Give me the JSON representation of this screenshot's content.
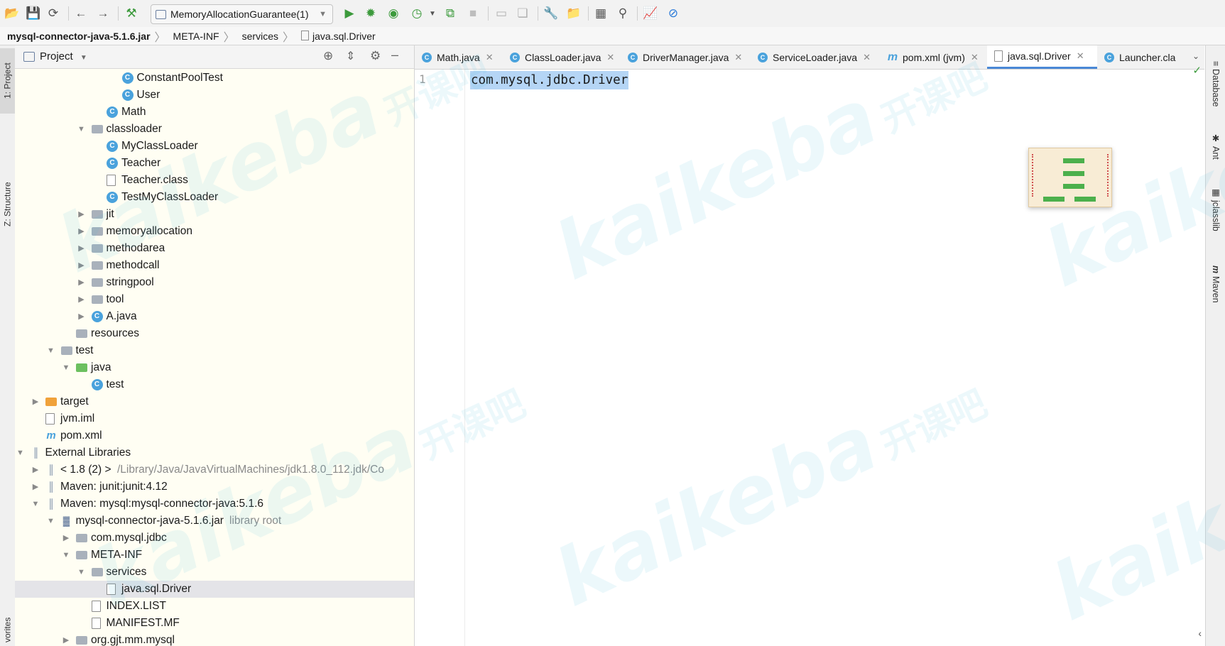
{
  "toolbar": {
    "run_config": "MemoryAllocationGuarantee(1)",
    "icons": [
      "open-folder-icon",
      "save-icon",
      "sync-icon",
      "back-icon",
      "forward-icon",
      "build-hammer-icon",
      "run-icon",
      "debug-icon",
      "coverage-icon",
      "profile-icon",
      "attach-debugger-icon",
      "stop-icon",
      "device-icon",
      "device-manager-icon",
      "settings-wrench-icon",
      "project-structure-icon",
      "terminal-icon",
      "search-icon",
      "activity-monitor-icon",
      "power-save-icon"
    ]
  },
  "breadcrumb": [
    "mysql-connector-java-5.1.6.jar",
    "META-INF",
    "services",
    "java.sql.Driver"
  ],
  "left_stripe": {
    "project": "1: Project",
    "structure": "Z: Structure",
    "favorites": "vorites"
  },
  "project_panel": {
    "title": "Project",
    "rows": [
      {
        "label": "ConstantPoolTest",
        "icon": "class",
        "level": 7,
        "arrow": ""
      },
      {
        "label": "User",
        "icon": "class",
        "level": 7,
        "arrow": ""
      },
      {
        "label": "Math",
        "icon": "class-run",
        "level": 6,
        "arrow": ""
      },
      {
        "label": "classloader",
        "icon": "folder",
        "level": 5,
        "arrow": "open"
      },
      {
        "label": "MyClassLoader",
        "icon": "class",
        "level": 6,
        "arrow": ""
      },
      {
        "label": "Teacher",
        "icon": "class",
        "level": 6,
        "arrow": ""
      },
      {
        "label": "Teacher.class",
        "icon": "binary",
        "level": 6,
        "arrow": ""
      },
      {
        "label": "TestMyClassLoader",
        "icon": "class-run",
        "level": 6,
        "arrow": ""
      },
      {
        "label": "jit",
        "icon": "folder",
        "level": 5,
        "arrow": "closed"
      },
      {
        "label": "memoryallocation",
        "icon": "folder",
        "level": 5,
        "arrow": "closed"
      },
      {
        "label": "methodarea",
        "icon": "folder",
        "level": 5,
        "arrow": "closed"
      },
      {
        "label": "methodcall",
        "icon": "folder",
        "level": 5,
        "arrow": "closed"
      },
      {
        "label": "stringpool",
        "icon": "folder",
        "level": 5,
        "arrow": "closed"
      },
      {
        "label": "tool",
        "icon": "folder",
        "level": 5,
        "arrow": "closed"
      },
      {
        "label": "A.java",
        "icon": "class-run",
        "level": 5,
        "arrow": "closed"
      },
      {
        "label": "resources",
        "icon": "resources",
        "level": 4,
        "arrow": ""
      },
      {
        "label": "test",
        "icon": "folder",
        "level": 3,
        "arrow": "open"
      },
      {
        "label": "java",
        "icon": "folder-src",
        "level": 4,
        "arrow": "open"
      },
      {
        "label": "test",
        "icon": "class-run",
        "level": 5,
        "arrow": ""
      },
      {
        "label": "target",
        "icon": "folder-orange",
        "level": 2,
        "arrow": "closed"
      },
      {
        "label": "jvm.iml",
        "icon": "file",
        "level": 2,
        "arrow": ""
      },
      {
        "label": "pom.xml",
        "icon": "maven",
        "level": 2,
        "arrow": ""
      },
      {
        "label": "External Libraries",
        "icon": "library",
        "level": 1,
        "arrow": "open"
      },
      {
        "label": "< 1.8 (2) >",
        "sub": "/Library/Java/JavaVirtualMachines/jdk1.8.0_112.jdk/Co",
        "icon": "jdk",
        "level": 2,
        "arrow": "closed"
      },
      {
        "label": "Maven: junit:junit:4.12",
        "icon": "library",
        "level": 2,
        "arrow": "closed"
      },
      {
        "label": "Maven: mysql:mysql-connector-java:5.1.6",
        "icon": "library",
        "level": 2,
        "arrow": "open"
      },
      {
        "label": "mysql-connector-java-5.1.6.jar",
        "sub": "library root",
        "icon": "jar",
        "level": 3,
        "arrow": "open"
      },
      {
        "label": "com.mysql.jdbc",
        "icon": "folder",
        "level": 4,
        "arrow": "closed"
      },
      {
        "label": "META-INF",
        "icon": "folder",
        "level": 4,
        "arrow": "open"
      },
      {
        "label": "services",
        "icon": "folder",
        "level": 5,
        "arrow": "open"
      },
      {
        "label": "java.sql.Driver",
        "icon": "file",
        "level": 6,
        "arrow": "",
        "selected": true
      },
      {
        "label": "INDEX.LIST",
        "icon": "file",
        "level": 5,
        "arrow": ""
      },
      {
        "label": "MANIFEST.MF",
        "icon": "manifest",
        "level": 5,
        "arrow": ""
      },
      {
        "label": "org.gjt.mm.mysql",
        "icon": "folder",
        "level": 4,
        "arrow": "closed"
      }
    ]
  },
  "editor": {
    "tabs": [
      {
        "label": "Math.java",
        "icon": "class-run"
      },
      {
        "label": "ClassLoader.java",
        "icon": "class-lock"
      },
      {
        "label": "DriverManager.java",
        "icon": "class-lock"
      },
      {
        "label": "ServiceLoader.java",
        "icon": "class-lock"
      },
      {
        "label": "pom.xml (jvm)",
        "icon": "maven"
      },
      {
        "label": "java.sql.Driver",
        "icon": "file",
        "active": true
      },
      {
        "label": "Launcher.cla",
        "icon": "class-lock"
      }
    ],
    "line_number": "1",
    "code": "com.mysql.jdbc.Driver"
  },
  "right_stripe": [
    "Database",
    "Ant",
    "jclasslib",
    "Maven"
  ],
  "watermark": {
    "text": "kaikeba",
    "cn": "开课吧",
    "color": "#4cc0e0"
  },
  "colors": {
    "selection": "#b5d5f5",
    "active_tab": "#4a88d6",
    "class_icon": "#4aa2dc",
    "panel_bg": "#fffef3"
  }
}
